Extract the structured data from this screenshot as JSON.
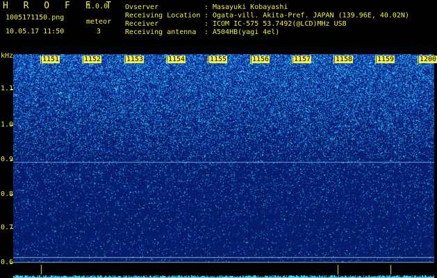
{
  "header": {
    "app_title": "H R O F F T",
    "version": "1.0.0",
    "filename": "1005171150.png",
    "datetime": "10.05.17 11:50",
    "meteor_label": "meteor",
    "meteor_count": "3",
    "info": [
      {
        "label": "Ovserver",
        "sep": ":",
        "value": "Masayuki Kobayashi"
      },
      {
        "label": "Receiving Location",
        "sep": ":",
        "value": "Ogata-vill. Akita-Pref. JAPAN (139.96E, 40.02N)"
      },
      {
        "label": "Receiver",
        "sep": ":",
        "value": "ICOM IC-575 53.7492(@LCD)MHz USB"
      },
      {
        "label": "Receiving antenna",
        "sep": ":",
        "value": "A504HB(yagi 4el)"
      }
    ]
  },
  "y_axis": {
    "unit": "kHz",
    "ticks": [
      "1.1",
      "1.0",
      "0.9",
      "0.8",
      "0.7",
      "0.6"
    ]
  },
  "x_axis": {
    "ticks": [
      "1151",
      "1152",
      "1153",
      "1154",
      "1155",
      "1156",
      "1157",
      "1158",
      "1159",
      "1200"
    ]
  },
  "colors": {
    "text": "#f0f04a",
    "background": "#000000",
    "spectrogram_low": "#061c6a",
    "spectrogram_high": "#39d7ff"
  }
}
